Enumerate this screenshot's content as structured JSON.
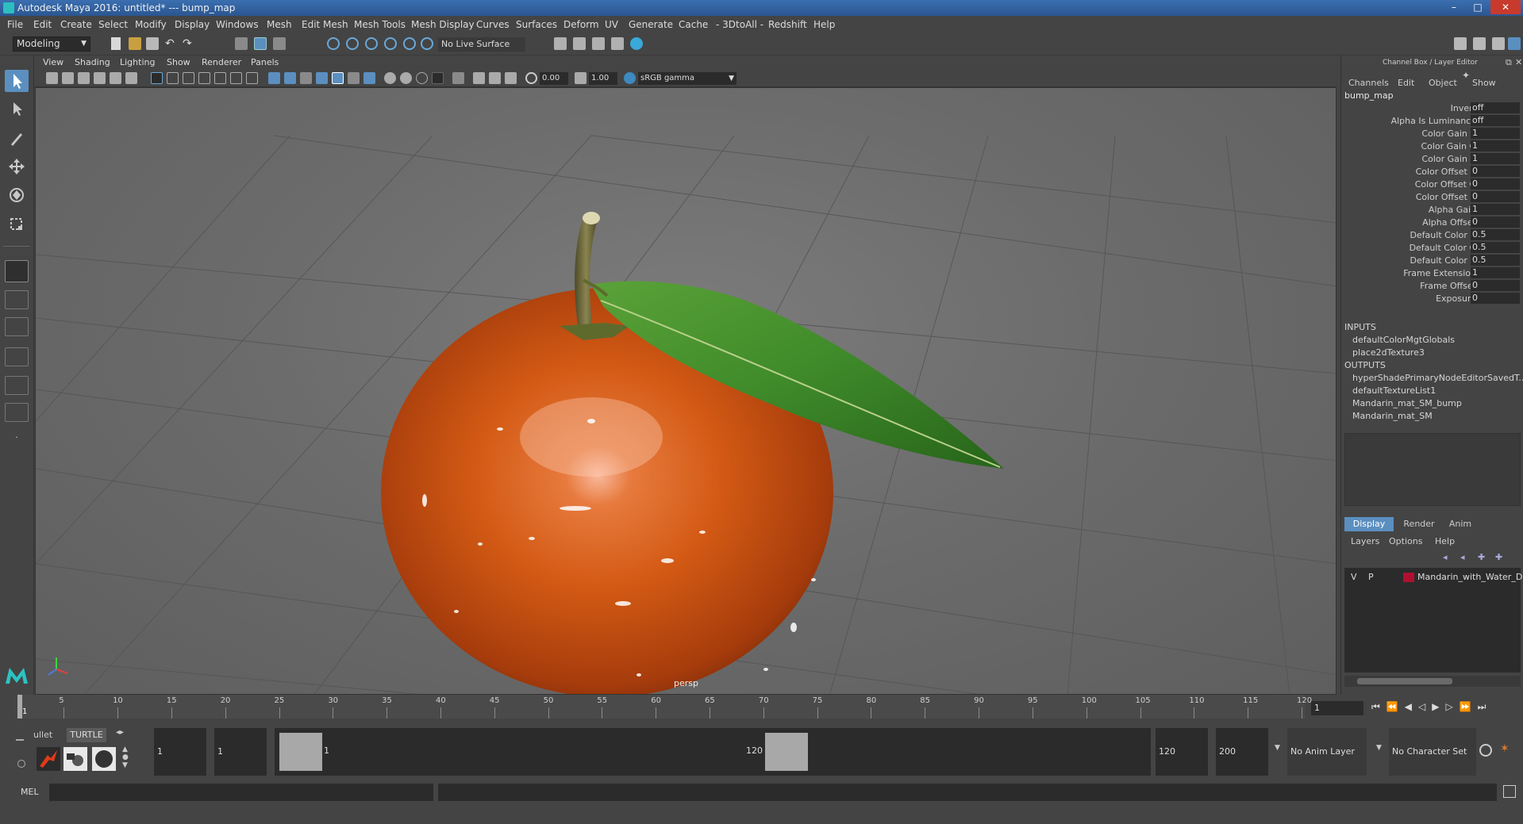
{
  "window": {
    "title": "Autodesk Maya 2016: untitled*   ---   bump_map",
    "controls": [
      "–",
      "□",
      "✕"
    ]
  },
  "menubar": [
    "File",
    "Edit",
    "Create",
    "Select",
    "Modify",
    "Display",
    "Windows",
    "Mesh",
    "Edit Mesh",
    "Mesh Tools",
    "Mesh Display",
    "Curves",
    "Surfaces",
    "Deform",
    "UV",
    "Generate",
    "Cache",
    "- 3DtoAll -",
    "Redshift",
    "Help"
  ],
  "shelf": {
    "mode": "Modeling",
    "live_surface": "No Live Surface"
  },
  "viewport": {
    "menus": [
      "View",
      "Shading",
      "Lighting",
      "Show",
      "Renderer",
      "Panels"
    ],
    "field_a": "0.00",
    "field_b": "1.00",
    "color_space": "sRGB gamma",
    "camera_label": "persp"
  },
  "channel_box": {
    "header": "Channel Box / Layer Editor",
    "tabs": [
      "Channels",
      "Edit",
      "Object",
      "Show"
    ],
    "node_name": "bump_map",
    "attributes": [
      {
        "label": "Invert",
        "value": "off"
      },
      {
        "label": "Alpha Is Luminance",
        "value": "off"
      },
      {
        "label": "Color Gain R",
        "value": "1"
      },
      {
        "label": "Color Gain G",
        "value": "1"
      },
      {
        "label": "Color Gain B",
        "value": "1"
      },
      {
        "label": "Color Offset R",
        "value": "0"
      },
      {
        "label": "Color Offset G",
        "value": "0"
      },
      {
        "label": "Color Offset B",
        "value": "0"
      },
      {
        "label": "Alpha Gain",
        "value": "1"
      },
      {
        "label": "Alpha Offset",
        "value": "0"
      },
      {
        "label": "Default Color R",
        "value": "0.5"
      },
      {
        "label": "Default Color G",
        "value": "0.5"
      },
      {
        "label": "Default Color B",
        "value": "0.5"
      },
      {
        "label": "Frame Extension",
        "value": "1"
      },
      {
        "label": "Frame Offset",
        "value": "0"
      },
      {
        "label": "Exposure",
        "value": "0"
      }
    ],
    "inputs_label": "INPUTS",
    "inputs": [
      "defaultColorMgtGlobals",
      "place2dTexture3"
    ],
    "outputs_label": "OUTPUTS",
    "outputs": [
      "hyperShadePrimaryNodeEditorSavedT...",
      "defaultTextureList1",
      "Mandarin_mat_SM_bump",
      "Mandarin_mat_SM"
    ]
  },
  "layer_editor": {
    "tabs": [
      "Display",
      "Render",
      "Anim"
    ],
    "menus": [
      "Layers",
      "Options",
      "Help"
    ],
    "layer": {
      "v": "V",
      "p": "P",
      "name": "Mandarin_with_Water_D",
      "color": "#b01030"
    }
  },
  "timeline": {
    "ticks": [
      "5",
      "10",
      "15",
      "20",
      "25",
      "30",
      "35",
      "40",
      "45",
      "50",
      "55",
      "60",
      "65",
      "70",
      "75",
      "80",
      "85",
      "90",
      "95",
      "100",
      "105",
      "110",
      "115",
      "120"
    ],
    "start_label": "1",
    "current_frame": "1"
  },
  "range": {
    "shelf_tabs": [
      "ullet",
      "TURTLE"
    ],
    "start_a": "1",
    "start_b": "1",
    "range_start": "1",
    "range_end": "120",
    "end_a": "120",
    "end_b": "200",
    "anim_layer": "No Anim Layer",
    "char_set": "No Character Set"
  },
  "mel": {
    "label": "MEL"
  },
  "colors": {
    "accent": "#3d8ac0",
    "bg": "#444444",
    "field": "#2b2b2b",
    "orange": "#d85a14",
    "leaf": "#3f8a2a"
  }
}
